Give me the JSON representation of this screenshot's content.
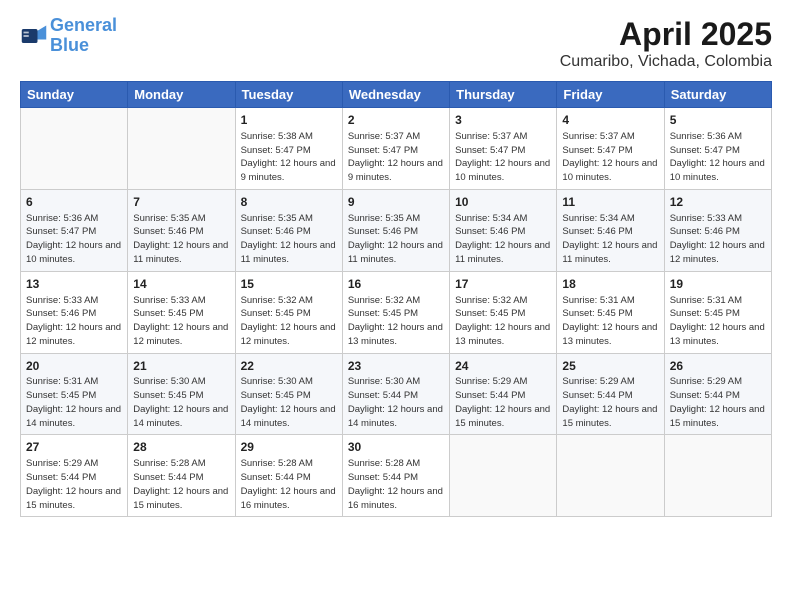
{
  "header": {
    "logo_line1": "General",
    "logo_line2": "Blue",
    "title": "April 2025",
    "subtitle": "Cumaribo, Vichada, Colombia"
  },
  "days_of_week": [
    "Sunday",
    "Monday",
    "Tuesday",
    "Wednesday",
    "Thursday",
    "Friday",
    "Saturday"
  ],
  "weeks": [
    [
      {
        "day": "",
        "info": ""
      },
      {
        "day": "",
        "info": ""
      },
      {
        "day": "1",
        "info": "Sunrise: 5:38 AM\nSunset: 5:47 PM\nDaylight: 12 hours and 9 minutes."
      },
      {
        "day": "2",
        "info": "Sunrise: 5:37 AM\nSunset: 5:47 PM\nDaylight: 12 hours and 9 minutes."
      },
      {
        "day": "3",
        "info": "Sunrise: 5:37 AM\nSunset: 5:47 PM\nDaylight: 12 hours and 10 minutes."
      },
      {
        "day": "4",
        "info": "Sunrise: 5:37 AM\nSunset: 5:47 PM\nDaylight: 12 hours and 10 minutes."
      },
      {
        "day": "5",
        "info": "Sunrise: 5:36 AM\nSunset: 5:47 PM\nDaylight: 12 hours and 10 minutes."
      }
    ],
    [
      {
        "day": "6",
        "info": "Sunrise: 5:36 AM\nSunset: 5:47 PM\nDaylight: 12 hours and 10 minutes."
      },
      {
        "day": "7",
        "info": "Sunrise: 5:35 AM\nSunset: 5:46 PM\nDaylight: 12 hours and 11 minutes."
      },
      {
        "day": "8",
        "info": "Sunrise: 5:35 AM\nSunset: 5:46 PM\nDaylight: 12 hours and 11 minutes."
      },
      {
        "day": "9",
        "info": "Sunrise: 5:35 AM\nSunset: 5:46 PM\nDaylight: 12 hours and 11 minutes."
      },
      {
        "day": "10",
        "info": "Sunrise: 5:34 AM\nSunset: 5:46 PM\nDaylight: 12 hours and 11 minutes."
      },
      {
        "day": "11",
        "info": "Sunrise: 5:34 AM\nSunset: 5:46 PM\nDaylight: 12 hours and 11 minutes."
      },
      {
        "day": "12",
        "info": "Sunrise: 5:33 AM\nSunset: 5:46 PM\nDaylight: 12 hours and 12 minutes."
      }
    ],
    [
      {
        "day": "13",
        "info": "Sunrise: 5:33 AM\nSunset: 5:46 PM\nDaylight: 12 hours and 12 minutes."
      },
      {
        "day": "14",
        "info": "Sunrise: 5:33 AM\nSunset: 5:45 PM\nDaylight: 12 hours and 12 minutes."
      },
      {
        "day": "15",
        "info": "Sunrise: 5:32 AM\nSunset: 5:45 PM\nDaylight: 12 hours and 12 minutes."
      },
      {
        "day": "16",
        "info": "Sunrise: 5:32 AM\nSunset: 5:45 PM\nDaylight: 12 hours and 13 minutes."
      },
      {
        "day": "17",
        "info": "Sunrise: 5:32 AM\nSunset: 5:45 PM\nDaylight: 12 hours and 13 minutes."
      },
      {
        "day": "18",
        "info": "Sunrise: 5:31 AM\nSunset: 5:45 PM\nDaylight: 12 hours and 13 minutes."
      },
      {
        "day": "19",
        "info": "Sunrise: 5:31 AM\nSunset: 5:45 PM\nDaylight: 12 hours and 13 minutes."
      }
    ],
    [
      {
        "day": "20",
        "info": "Sunrise: 5:31 AM\nSunset: 5:45 PM\nDaylight: 12 hours and 14 minutes."
      },
      {
        "day": "21",
        "info": "Sunrise: 5:30 AM\nSunset: 5:45 PM\nDaylight: 12 hours and 14 minutes."
      },
      {
        "day": "22",
        "info": "Sunrise: 5:30 AM\nSunset: 5:45 PM\nDaylight: 12 hours and 14 minutes."
      },
      {
        "day": "23",
        "info": "Sunrise: 5:30 AM\nSunset: 5:44 PM\nDaylight: 12 hours and 14 minutes."
      },
      {
        "day": "24",
        "info": "Sunrise: 5:29 AM\nSunset: 5:44 PM\nDaylight: 12 hours and 15 minutes."
      },
      {
        "day": "25",
        "info": "Sunrise: 5:29 AM\nSunset: 5:44 PM\nDaylight: 12 hours and 15 minutes."
      },
      {
        "day": "26",
        "info": "Sunrise: 5:29 AM\nSunset: 5:44 PM\nDaylight: 12 hours and 15 minutes."
      }
    ],
    [
      {
        "day": "27",
        "info": "Sunrise: 5:29 AM\nSunset: 5:44 PM\nDaylight: 12 hours and 15 minutes."
      },
      {
        "day": "28",
        "info": "Sunrise: 5:28 AM\nSunset: 5:44 PM\nDaylight: 12 hours and 15 minutes."
      },
      {
        "day": "29",
        "info": "Sunrise: 5:28 AM\nSunset: 5:44 PM\nDaylight: 12 hours and 16 minutes."
      },
      {
        "day": "30",
        "info": "Sunrise: 5:28 AM\nSunset: 5:44 PM\nDaylight: 12 hours and 16 minutes."
      },
      {
        "day": "",
        "info": ""
      },
      {
        "day": "",
        "info": ""
      },
      {
        "day": "",
        "info": ""
      }
    ]
  ]
}
